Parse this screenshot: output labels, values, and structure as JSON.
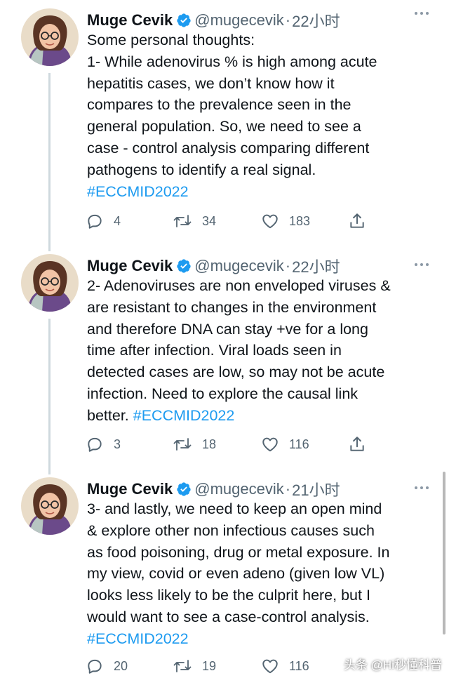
{
  "tweets": [
    {
      "name": "Muge Cevik",
      "handle": "@mugecevik",
      "sep": "·",
      "time": "22小时",
      "lines": [
        "Some personal thoughts:",
        "1- While adenovirus % is high among acute",
        "hepatitis cases, we don’t know how it",
        "compares to the prevalence seen in the",
        "general population. So, we need to see a",
        "case - control analysis comparing different",
        "pathogens to identify a real signal."
      ],
      "hashtag_line_prefix": "",
      "hashtag": "#ECCMID2022",
      "replies": "4",
      "retweets": "34",
      "likes": "183"
    },
    {
      "name": "Muge Cevik",
      "handle": "@mugecevik",
      "sep": "·",
      "time": "22小时",
      "lines": [
        "2- Adenoviruses are non enveloped viruses &",
        "are resistant to changes in the environment",
        "and therefore DNA can stay +ve for a long",
        "time after infection. Viral loads seen in",
        "detected cases are low, so may not be acute",
        "infection. Need to explore the causal link"
      ],
      "hashtag_line_prefix": "better. ",
      "hashtag": "#ECCMID2022",
      "replies": "3",
      "retweets": "18",
      "likes": "116"
    },
    {
      "name": "Muge Cevik",
      "handle": "@mugecevik",
      "sep": "·",
      "time": "21小时",
      "lines": [
        "3- and lastly, we need to keep an open mind",
        "& explore other non infectious causes such",
        "as food poisoning, drug or metal exposure. In",
        "my view, covid or even adeno (given low VL)",
        "looks less likely to be the culprit here, but I",
        "would want to see a case-control analysis."
      ],
      "hashtag_line_prefix": "",
      "hashtag": "#ECCMID2022",
      "replies": "20",
      "retweets": "19",
      "likes": "116"
    }
  ],
  "watermark": "头条 @Hi秒懂科普",
  "colors": {
    "text": "#0f1419",
    "secondary": "#536471",
    "link": "#1d9bf0",
    "verified": "#1d9bf0",
    "thread_line": "#cfd9de"
  },
  "icons": [
    "verified-badge-icon",
    "more-icon",
    "reply-icon",
    "retweet-icon",
    "like-icon",
    "share-icon"
  ]
}
